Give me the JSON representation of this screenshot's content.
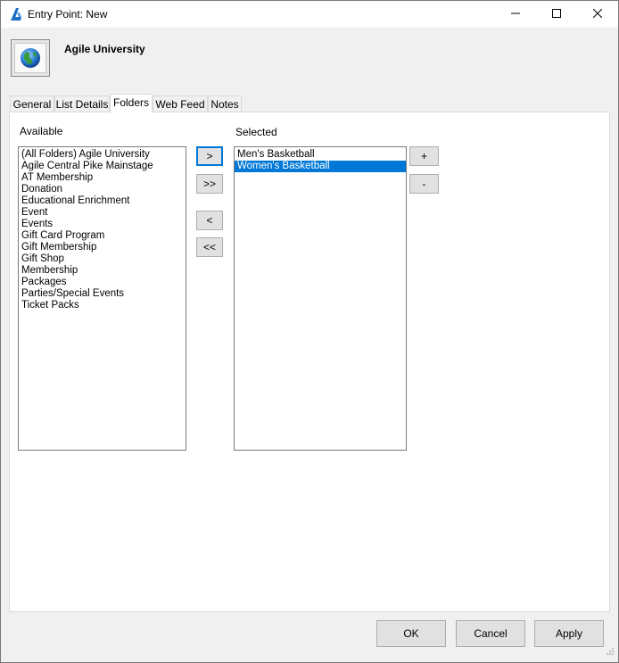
{
  "window": {
    "title": "Entry Point: New",
    "icons": {
      "app": "agile-logo-icon",
      "minimize": "minimize-icon",
      "maximize": "maximize-icon",
      "close": "close-icon"
    }
  },
  "header": {
    "title": "Agile University",
    "icon": "globe-icon"
  },
  "tabs": [
    {
      "label": "General"
    },
    {
      "label": "List Details"
    },
    {
      "label": "Folders",
      "active": true
    },
    {
      "label": "Web Feed"
    },
    {
      "label": "Notes"
    }
  ],
  "folders": {
    "available_label": "Available",
    "selected_label": "Selected",
    "available_items": [
      "(All Folders) Agile University",
      "Agile Central Pike Mainstage",
      "AT Membership",
      "Donation",
      "Educational Enrichment",
      "Event",
      "Events",
      "Gift Card Program",
      "Gift Membership",
      "Gift Shop",
      "Membership",
      "Packages",
      "Parties/Special Events",
      "Ticket Packs"
    ],
    "selected_items": [
      {
        "label": "Men's Basketball",
        "selected": false
      },
      {
        "label": "Women's Basketball",
        "selected": true
      }
    ],
    "move_buttons": {
      "add": ">",
      "add_all": ">>",
      "remove": "<",
      "remove_all": "<<"
    },
    "order_buttons": {
      "up": "+",
      "down": "-"
    }
  },
  "footer": {
    "ok": "OK",
    "cancel": "Cancel",
    "apply": "Apply"
  },
  "colors": {
    "selection": "#0078d7",
    "window_bg": "#f0f0f0",
    "button_bg": "#e1e1e1"
  }
}
